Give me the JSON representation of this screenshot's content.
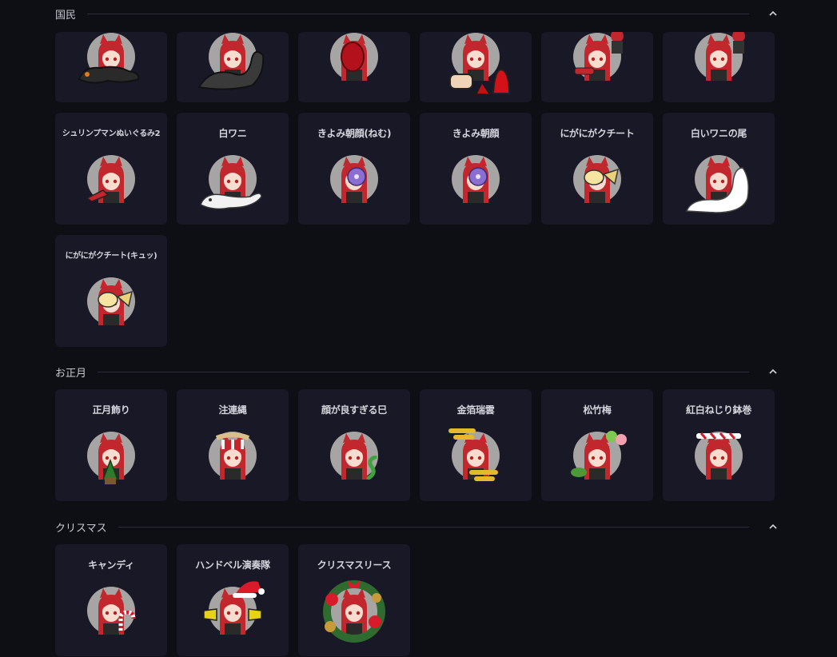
{
  "sections": [
    {
      "title": "国民",
      "collapse_icon": "chevron-up-icon"
    },
    {
      "title": "お正月",
      "collapse_icon": "chevron-up-icon"
    },
    {
      "title": "クリスマス",
      "collapse_icon": "chevron-up-icon"
    }
  ],
  "kokumin": {
    "partial_row": [
      {
        "decoration": "black-crocodile-icon"
      },
      {
        "decoration": "gray-crocodile-icon"
      },
      {
        "decoration": "red-creature-icon"
      },
      {
        "decoration": "hand-and-red-blob-icon"
      },
      {
        "decoration": "red-mini-character-icon"
      },
      {
        "decoration": "red-mini-character-icon"
      }
    ],
    "items": [
      {
        "label": "シュリンプマンぬいぐるみ2",
        "decoration": "shrimp-plush-icon"
      },
      {
        "label": "白ワニ",
        "decoration": "white-crocodile-icon"
      },
      {
        "label": "きよみ朝顔(ねむ)",
        "decoration": "morning-glory-icon"
      },
      {
        "label": "きよみ朝顔",
        "decoration": "morning-glory-icon"
      },
      {
        "label": "にがにがクチート",
        "decoration": "mawile-icon"
      },
      {
        "label": "白いワニの尾",
        "decoration": "white-tail-icon"
      },
      {
        "label": "にがにがクチート(キュッ)",
        "decoration": "mawile-icon"
      }
    ]
  },
  "oshogatsu": {
    "items": [
      {
        "label": "正月飾り",
        "decoration": "kadomatsu-icon"
      },
      {
        "label": "注連縄",
        "decoration": "shimenawa-icon"
      },
      {
        "label": "顔が良すぎる巳",
        "decoration": "green-snake-icon"
      },
      {
        "label": "金箔瑞雲",
        "decoration": "gold-cloud-icon"
      },
      {
        "label": "松竹梅",
        "decoration": "plum-blossom-icon"
      },
      {
        "label": "紅白ねじり鉢巻",
        "decoration": "headband-icon"
      }
    ]
  },
  "christmas": {
    "items": [
      {
        "label": "キャンディ",
        "decoration": "candy-cane-icon"
      },
      {
        "label": "ハンドベル演奏隊",
        "decoration": "santa-hat-handbell-icon"
      },
      {
        "label": "クリスマスリース",
        "decoration": "christmas-wreath-icon"
      }
    ]
  },
  "colors": {
    "background": "#0e0e15",
    "card": "#181827",
    "avatar_bg": "#a7a5a3",
    "hair": "#c1272d"
  }
}
